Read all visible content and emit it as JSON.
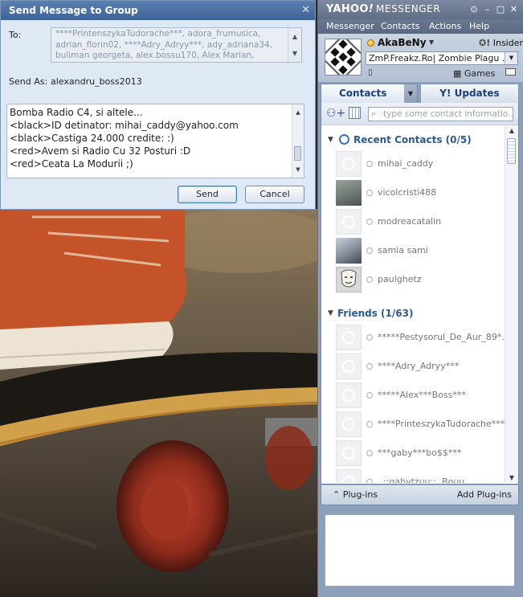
{
  "send_dialog": {
    "title": "Send Message to Group",
    "close_symbol": "✕",
    "to_label": "To:",
    "recipients": "****PrintenszykaTudorache***, adora_frumusica, adrian_florin02, ****Adry_Adryy***, ady_adriana34, buliman georgeta, alex.bossu170, Alex Marian,",
    "send_as_label": "Send As:",
    "send_as_value": "alexandru_boss2013",
    "message_lines": [
      "Bomba Radio C4, si altele...",
      "<black>ID detinator: mihai_caddy@yahoo.com",
      "<black>Castiga 24.000 credite: :)",
      "<red>Avem si Radio Cu 32 Posturi :D",
      "<red>Ceata La Modurii ;)"
    ],
    "send_button": "Send",
    "cancel_button": "Cancel"
  },
  "messenger": {
    "logo_brand": "YAHOO",
    "logo_bang": "!",
    "logo_product": "MESSENGER",
    "window_buttons": [
      "⊙",
      "–",
      "□",
      "✕"
    ],
    "menu": [
      "Messenger",
      "Contacts",
      "Actions",
      "Help"
    ],
    "user": {
      "name": "AkaBeNy",
      "status_message": "ZmP.Freakz.Ro| Zombie Plagu ...",
      "insider_label": "Insider",
      "games_label": "Games"
    },
    "tabs": {
      "contacts": "Contacts",
      "updates": "Y! Updates"
    },
    "search_placeholder": "type some contact informatio...",
    "groups": {
      "recent": {
        "label": "Recent Contacts (0/5)",
        "contacts": [
          "mihai_caddy",
          "vicolcristi488",
          "modreacatalin",
          "samia sami",
          "paulghetz"
        ]
      },
      "friends": {
        "label": "Friends (1/63)",
        "contacts": [
          "*****Pestysorul_De_Aur_89*...",
          "****Adry_Adryy***",
          "*****Alex***Boss***",
          "****PrinteszykaTudorache***",
          "***gaby***bo$$***",
          "..::gabytzuu::..Bouu"
        ]
      }
    },
    "plugins_label": "Plug-ins",
    "add_plugins_label": "Add Plug-ins"
  },
  "colors": {
    "dialog_title": "#4a70a6",
    "accent_blue": "#2c5a92",
    "status_yellow": "#e8a80a"
  }
}
